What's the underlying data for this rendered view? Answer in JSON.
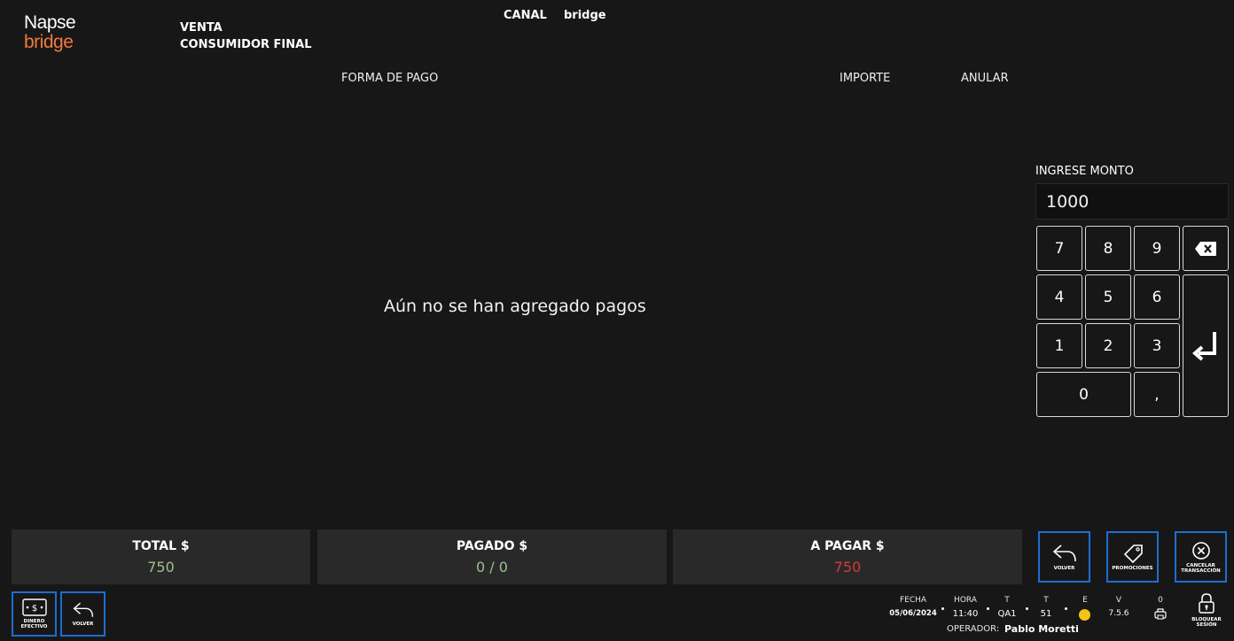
{
  "brand": {
    "line1": "Napse",
    "line2": "bridge"
  },
  "header": {
    "sale_type": "VENTA",
    "customer": "CONSUMIDOR FINAL",
    "canal_label": "CANAL",
    "canal_value": "bridge"
  },
  "payments_table": {
    "col_forma": "FORMA DE PAGO",
    "col_importe": "IMPORTE",
    "col_anular": "ANULAR",
    "empty_text": "Aún no se han agregado pagos"
  },
  "keypad": {
    "label": "INGRESE MONTO",
    "value": "1000",
    "keys": [
      "7",
      "8",
      "9",
      "4",
      "5",
      "6",
      "1",
      "2",
      "3",
      "0",
      ","
    ],
    "backspace_icon": "backspace-icon",
    "enter_icon": "enter-return-icon"
  },
  "totals": {
    "total_label": "TOTAL $",
    "total_value": "750",
    "pagado_label": "PAGADO $",
    "pagado_value": "0 / 0",
    "apagar_label": "A PAGAR $",
    "apagar_value": "750"
  },
  "actions": {
    "volver": "VOLVER",
    "promociones": "PROMOCIONES",
    "cancelar_1": "CANCELAR",
    "cancelar_2": "TRANSACCIÓN"
  },
  "footer_left": {
    "dinero_1": "DINERO",
    "dinero_2": "EFECTIVO",
    "volver": "VOLVER"
  },
  "status": {
    "fecha_label": "FECHA",
    "fecha_value": "05/06/2024",
    "hora_label": "HORA",
    "hora_value": "11:40",
    "t1_label": "T",
    "t1_value": "QA1",
    "t2_label": "T",
    "t2_value": "51",
    "e_label": "E",
    "v_label": "V",
    "v_value": "7.5.6",
    "o_label": "0",
    "operador_label": "OPERADOR:",
    "operador_value": "Pablo Moretti",
    "bloquear_1": "BLOQUEAR",
    "bloquear_2": "SESIÓN"
  },
  "colors": {
    "background": "#181718",
    "brand_orange": "#f07a3a",
    "accent_blue": "#1b6fd0",
    "total_green": "#9dc08b",
    "apagar_red": "#d23a3a",
    "status_yellow": "#f3c316"
  }
}
